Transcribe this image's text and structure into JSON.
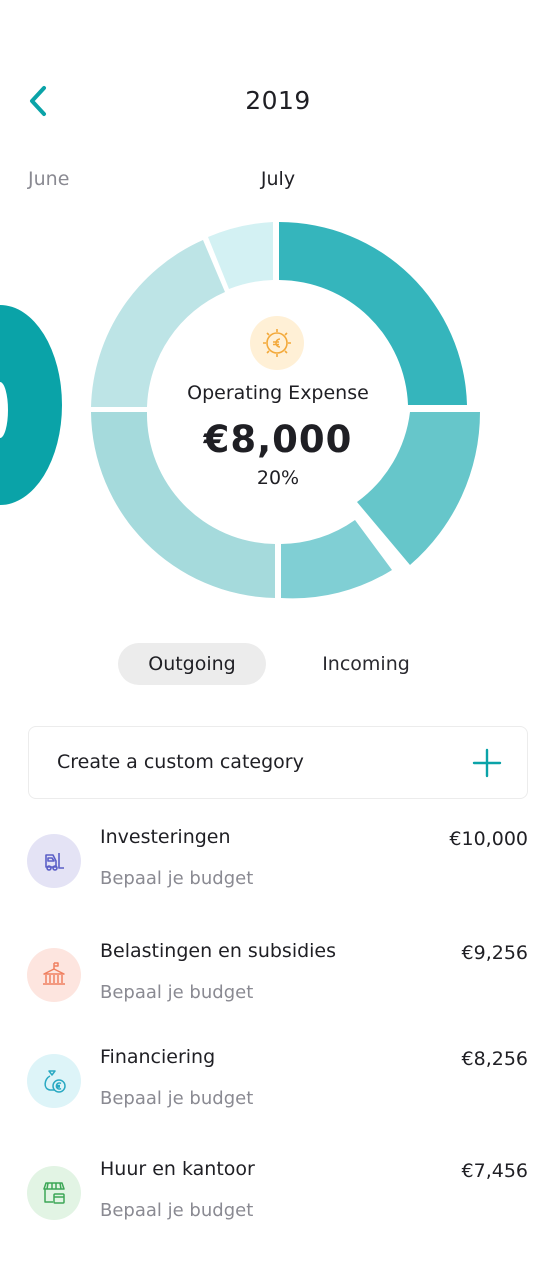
{
  "header": {
    "year": "2019"
  },
  "months": {
    "previous": "June",
    "current": "July"
  },
  "donut": {
    "center": {
      "label": "Operating Expense",
      "amount": "€8,000",
      "percent": "20%"
    },
    "colors": {
      "teal_dark": "#35b5bc",
      "teal_mid": "#66c6ca",
      "teal_soft": "#80cfd4",
      "teal_light": "#a5dadc",
      "teal_pale": "#bde4e6",
      "teal_faint": "#d3f1f3",
      "prev_month": "#0aa3a8"
    }
  },
  "segments": {
    "outgoing": "Outgoing",
    "incoming": "Incoming"
  },
  "custom_category": {
    "label": "Create a custom category",
    "icon": "plus-icon"
  },
  "categories": [
    {
      "title": "Investeringen",
      "subtitle": "Bepaal je budget",
      "amount": "€10,000",
      "icon": "forklift-icon",
      "icon_bg": "#e4e3f5",
      "icon_color": "#5b5fc7"
    },
    {
      "title": "Belastingen en subsidies",
      "subtitle": "Bepaal je budget",
      "amount": "€9,256",
      "icon": "government-building-icon",
      "icon_bg": "#fde5df",
      "icon_color": "#f08060"
    },
    {
      "title": "Financiering",
      "subtitle": "Bepaal je budget",
      "amount": "€8,256",
      "icon": "money-bag-icon",
      "icon_bg": "#ddf4f8",
      "icon_color": "#29a9c2"
    },
    {
      "title": "Huur en kantoor",
      "subtitle": "Bepaal je budget",
      "amount": "€7,456",
      "icon": "storefront-icon",
      "icon_bg": "#e2f4e4",
      "icon_color": "#3ca656"
    }
  ]
}
